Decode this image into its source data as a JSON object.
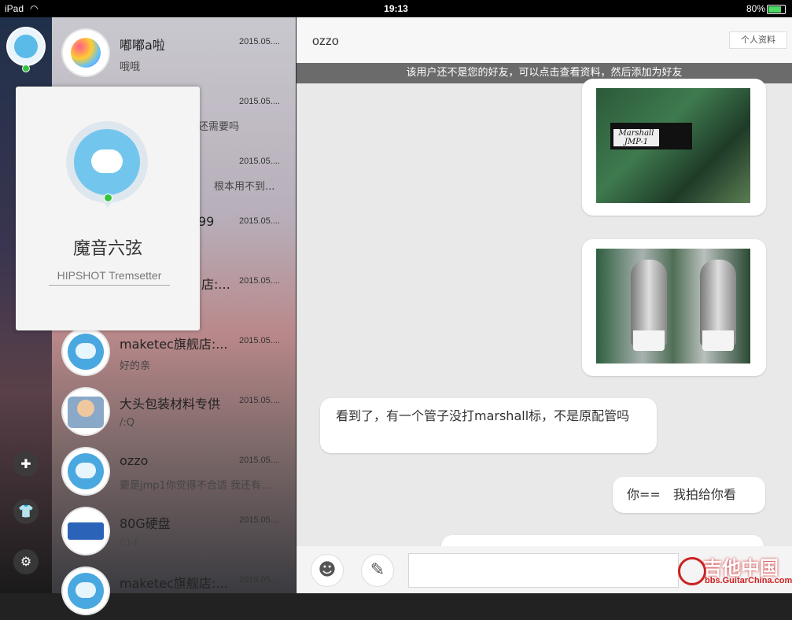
{
  "status_bar": {
    "device": "iPad",
    "time": "19:13",
    "battery": "80%",
    "battery_level": 0.8
  },
  "conversations": [
    {
      "name": "嘟嘟a啦",
      "date": "2015.05....",
      "message": "哦哦"
    },
    {
      "name": "",
      "date": "2015.05....",
      "message": "还需要吗"
    },
    {
      "name": "",
      "date": "2015.05....",
      "message": "根本用不到..."
    },
    {
      "name": "99",
      "date": "2015.05....",
      "message": ""
    },
    {
      "name": "店:...",
      "date": "2015.05....",
      "message": ""
    },
    {
      "name": "maketec旗舰店:...",
      "date": "2015.05....",
      "message": "好的亲"
    },
    {
      "name": "大头包装材料专供",
      "date": "2015.05....",
      "message": "/:Q"
    },
    {
      "name": "ozzo",
      "date": "2015.05....",
      "message": "要是jmp1你觉得不合适 我还有..."
    },
    {
      "name": "80G硬盘",
      "date": "2015.05....",
      "message": "/:)-("
    },
    {
      "name": "maketec旗舰店:...",
      "date": "2015.05....",
      "message": ""
    }
  ],
  "profile_popover": {
    "name": "魔音六弦",
    "signature": "HIPSHOT Tremsetter"
  },
  "chat": {
    "title": "ozzo",
    "profile_button": "个人资料",
    "notice": "该用户还不是您的好友，可以点击查看资料，然后添加为好友",
    "photo1_label": "Marshall\nJMP-1",
    "messages": [
      {
        "text": "看到了，有一个管子没打marshall标，不是原配管吗"
      },
      {
        "text": "你==　我拍给你看"
      }
    ]
  },
  "watermark": {
    "title": "吉他中国",
    "url": "bbs.GuitarChina.com"
  },
  "icons": {
    "rail": [
      "chat-add-icon",
      "shirt-icon",
      "gear-icon"
    ],
    "input": [
      "emoji-icon",
      "note-edit-icon"
    ]
  }
}
